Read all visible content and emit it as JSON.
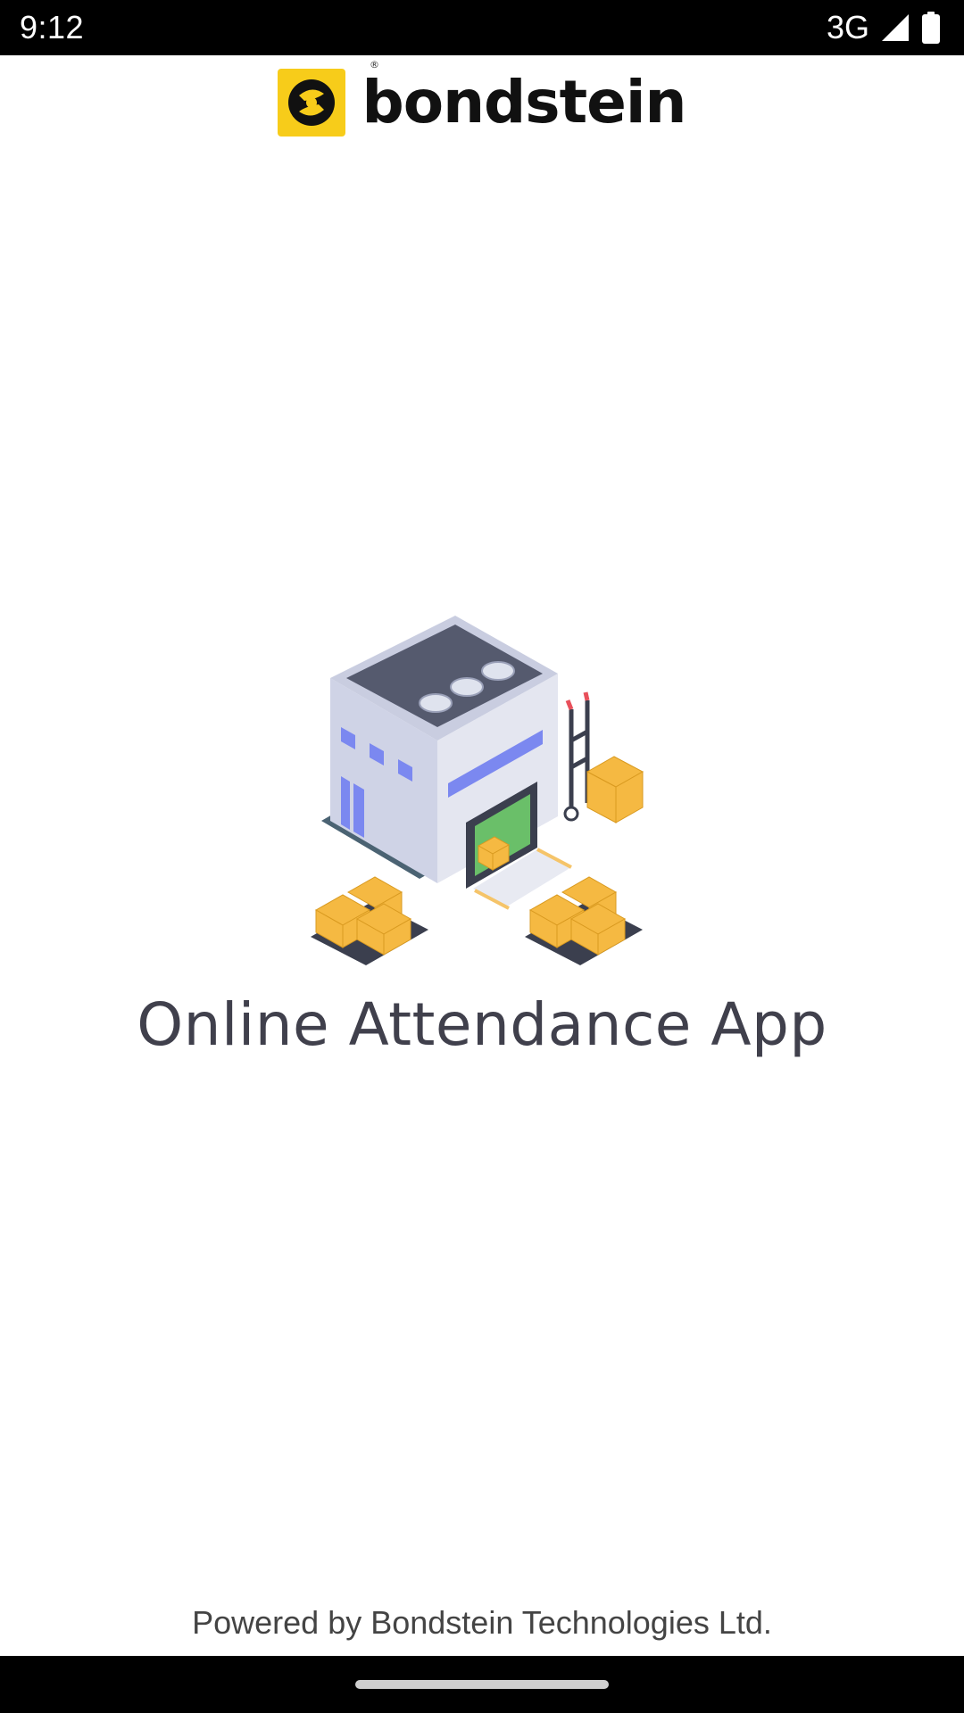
{
  "status_bar": {
    "time": "9:12",
    "network": "3G",
    "icons": [
      "signal-icon",
      "battery-icon"
    ]
  },
  "brand": {
    "name": "bondstein",
    "registered_mark": "®",
    "logo_icon": "bondstein-logo-icon",
    "accent_color": "#F7CC1A"
  },
  "illustration": {
    "icon": "warehouse-illustration"
  },
  "main": {
    "title": "Online Attendance App"
  },
  "footer": {
    "powered_by": "Powered by Bondstein Technologies Ltd."
  },
  "nav_bar": {
    "home_indicator": "home-indicator"
  }
}
